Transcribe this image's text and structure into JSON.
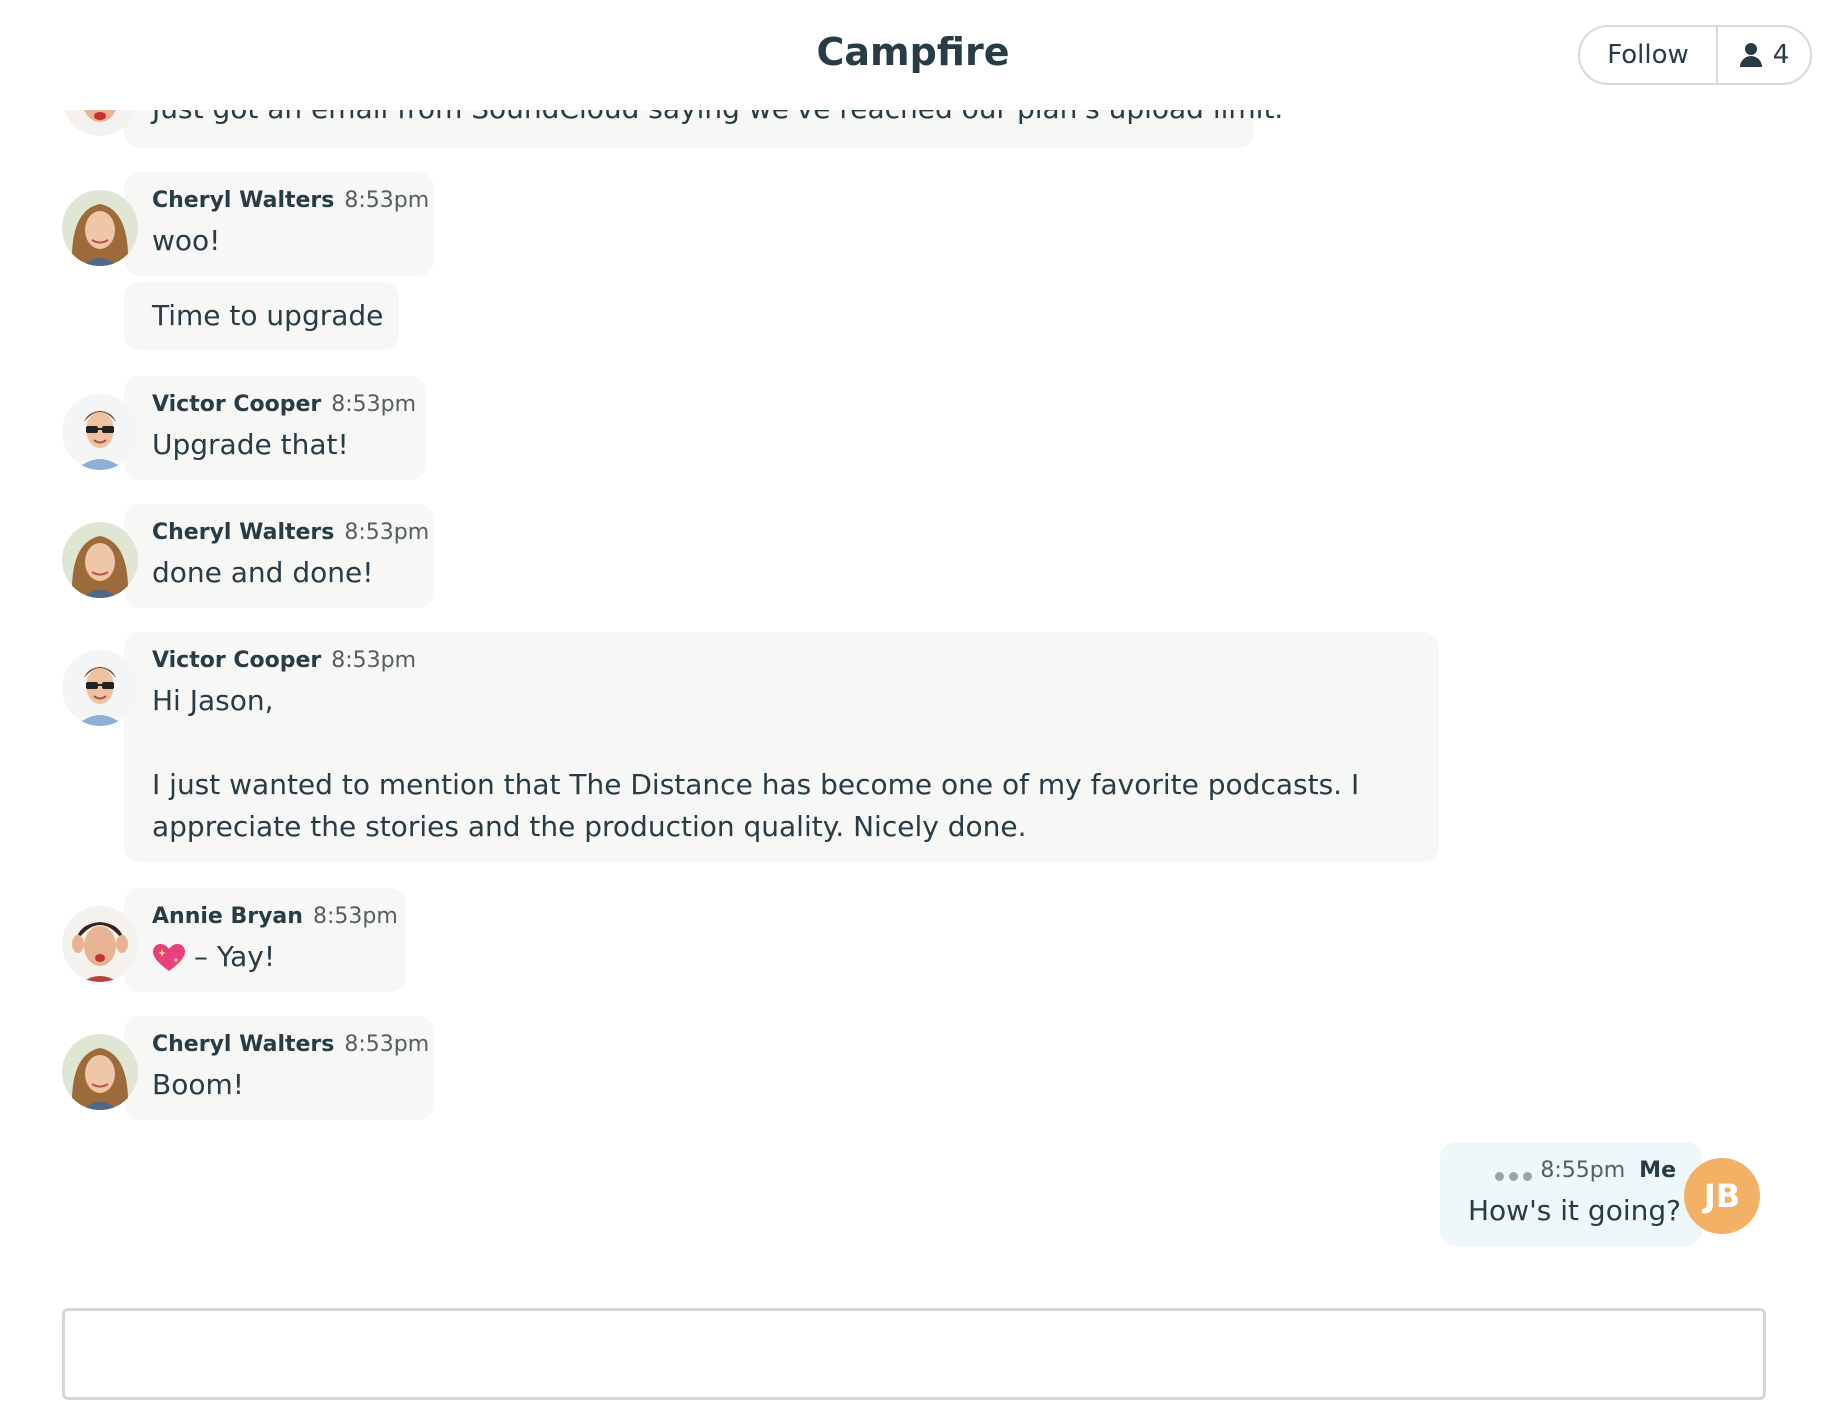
{
  "header": {
    "title": "Campfire",
    "follow_label": "Follow",
    "member_count": "4"
  },
  "messages": [
    {
      "text": "Just got an email from SoundCloud saying we've reached our plan's upload limit."
    },
    {
      "author": "Cheryl Walters",
      "time": "8:53pm",
      "text": "woo!"
    },
    {
      "text": "Time to upgrade"
    },
    {
      "author": "Victor Cooper",
      "time": "8:53pm",
      "text": "Upgrade that!"
    },
    {
      "author": "Cheryl Walters",
      "time": "8:53pm",
      "text": "done and done!"
    },
    {
      "author": "Victor Cooper",
      "time": "8:53pm",
      "lines": [
        "Hi Jason,",
        "I just wanted to mention that The Distance has become one of my favorite podcasts. I",
        "appreciate the stories and the production quality. Nicely done."
      ]
    },
    {
      "author": "Annie Bryan",
      "time": "8:53pm",
      "text": "– Yay!"
    },
    {
      "author": "Cheryl Walters",
      "time": "8:53pm",
      "text": "Boom!"
    }
  ],
  "my_message": {
    "author": "Me",
    "time": "8:55pm",
    "text": "How's it going?",
    "initials": "JB",
    "avatar_color": "#f3b166"
  },
  "icons": {
    "members": "person-icon",
    "reaction": "sparkling-heart-emoji"
  },
  "colors": {
    "bubble": "#f7f7f6",
    "my_bubble": "#eef7fa",
    "text": "#283c46"
  }
}
